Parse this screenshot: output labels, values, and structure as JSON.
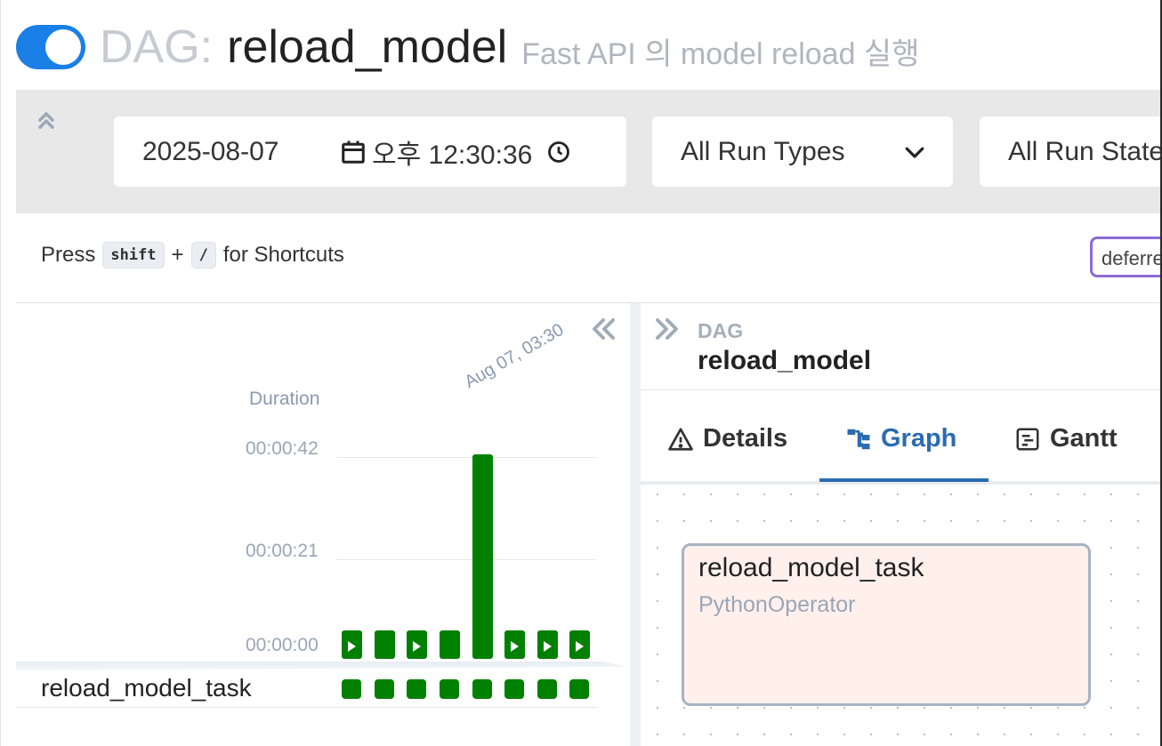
{
  "header": {
    "dag_prefix": "DAG:",
    "dag_name": "reload_model",
    "description": "Fast API 의 model reload 실행",
    "toggle_on": true
  },
  "filters": {
    "date": "2025-08-07",
    "time": "오후 12:30:36",
    "run_types": "All Run Types",
    "run_states": "All Run States"
  },
  "shortcuts": {
    "press": "Press",
    "key1": "shift",
    "plus": "+",
    "key2": "/",
    "suffix": "for Shortcuts"
  },
  "deferred_badge": "deferred",
  "grid": {
    "duration_label": "Duration",
    "y_ticks": [
      "00:00:42",
      "00:00:21",
      "00:00:00"
    ],
    "date_label": "Aug 07, 03:30",
    "task_name": "reload_model_task",
    "runs": [
      {
        "duration_s": 3,
        "play": true
      },
      {
        "duration_s": 3,
        "play": false
      },
      {
        "duration_s": 3,
        "play": true
      },
      {
        "duration_s": 3,
        "play": false
      },
      {
        "duration_s": 42,
        "play": false
      },
      {
        "duration_s": 3,
        "play": true
      },
      {
        "duration_s": 3,
        "play": true
      },
      {
        "duration_s": 3,
        "play": true
      }
    ],
    "status_color": "#008000"
  },
  "detail": {
    "crumb_small": "DAG",
    "crumb_big": "reload_model",
    "tabs": [
      "Details",
      "Graph",
      "Gantt"
    ],
    "active_tab": "Graph",
    "node_title": "reload_model_task",
    "node_operator": "PythonOperator"
  }
}
